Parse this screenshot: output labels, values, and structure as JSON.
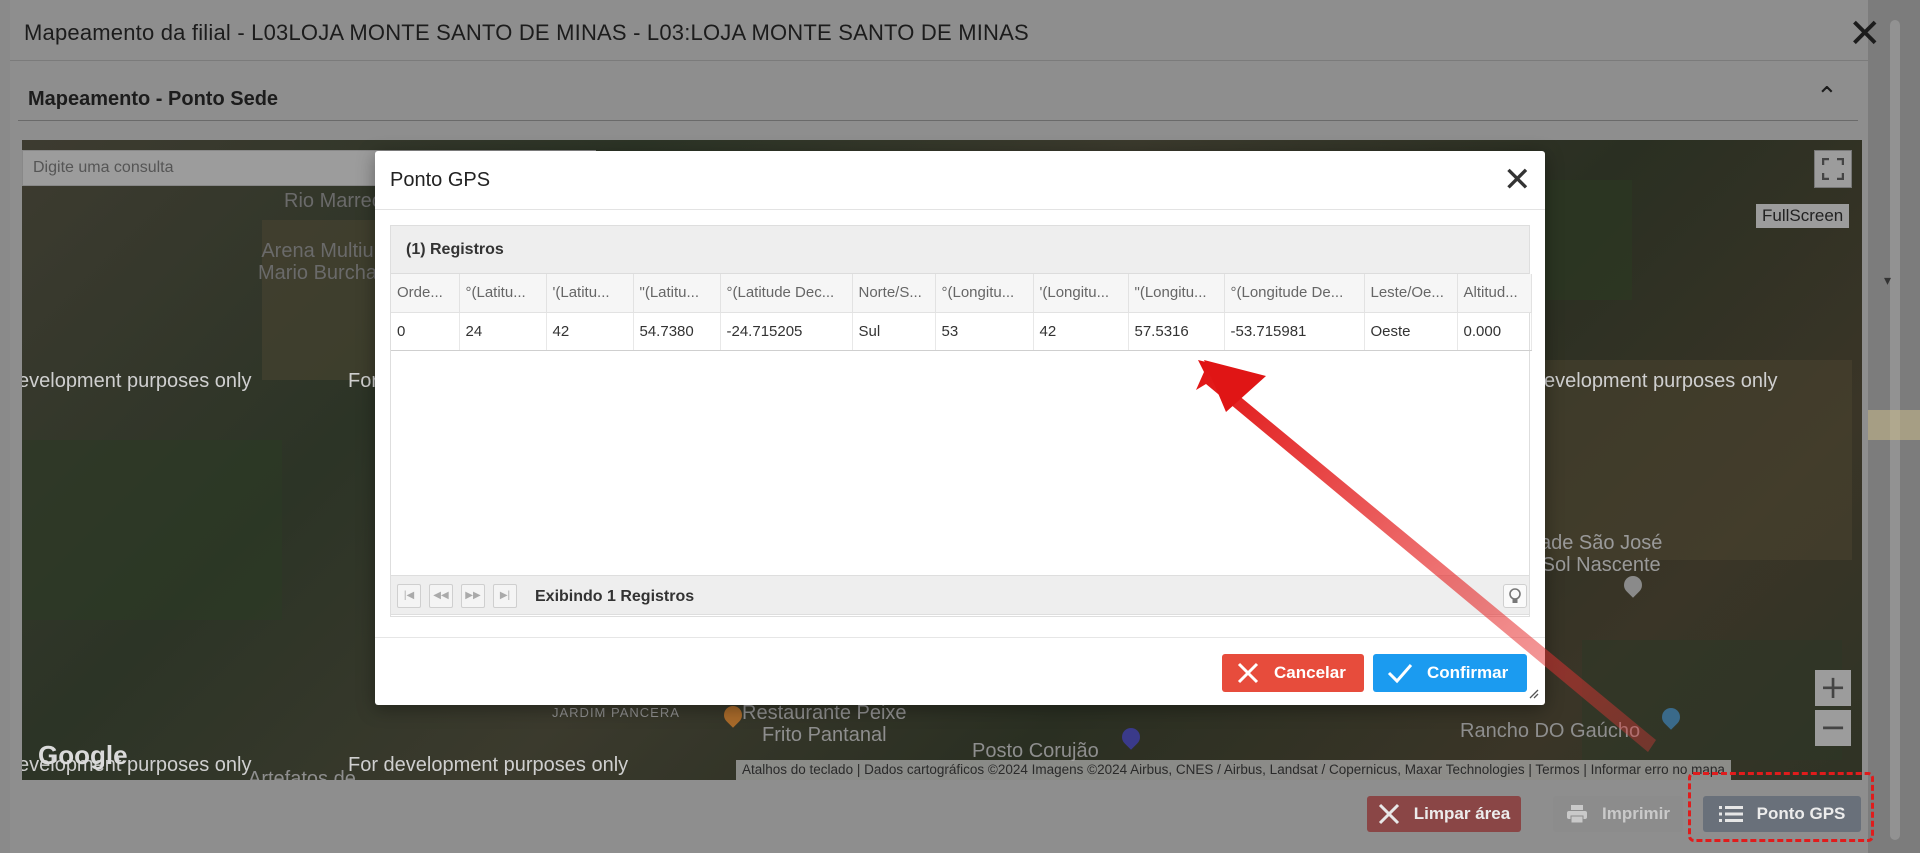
{
  "window": {
    "title": "Mapeamento da filial - L03LOJA MONTE SANTO DE MINAS - L03:LOJA MONTE SANTO DE MINAS",
    "section_title": "Mapeamento - Ponto Sede"
  },
  "map": {
    "search_placeholder": "Digite uma consulta",
    "fullscreen_label": "FullScreen",
    "zoom_in": "+",
    "zoom_out": "−",
    "google": "Google",
    "watermark": "For development purposes only",
    "watermark_partial": "evelopment purposes only",
    "watermark_partial2": "For",
    "places": {
      "rio": "Rio Marreco",
      "arena": "Arena Multiu\nMario Burcha",
      "saojose": "ade São José\nSol Nascente",
      "jardim": "JARDIM PANCERA",
      "restaurante": "Restaurante Peixe\nFrito Pantanal",
      "posto": "Posto Corujão",
      "rancho": "Rancho DO Gaúcho",
      "artefatos": "Artefatos de"
    },
    "attribution": "Atalhos do teclado  |  Dados cartográficos ©2024 Imagens ©2024 Airbus, CNES / Airbus, Landsat / Copernicus, Maxar Technologies  |  Termos  |  Informar erro no mapa"
  },
  "outer_buttons": {
    "limpar": "Limpar área",
    "imprimir": "Imprimir",
    "ponto": "Ponto GPS"
  },
  "modal": {
    "title": "Ponto GPS",
    "registros": "(1) Registros",
    "columns": [
      "Orde...",
      "°(Latitu...",
      "'(Latitu...",
      "\"(Latitu...",
      "°(Latitude Dec...",
      "Norte/S...",
      "°(Longitu...",
      "'(Longitu...",
      "\"(Longitu...",
      "°(Longitude De...",
      "Leste/Oe...",
      "Altitud..."
    ],
    "rows": [
      [
        "0",
        "24",
        "42",
        "54.7380",
        "-24.715205",
        "Sul",
        "53",
        "42",
        "57.5316",
        "-53.715981",
        "Oeste",
        "0.000"
      ]
    ],
    "pager_text": "Exibindo 1 Registros",
    "cancel": "Cancelar",
    "confirm": "Confirmar"
  },
  "colors": {
    "cancel": "#e74c3c",
    "confirm": "#1b9bf0",
    "annotation": "#e01c1c"
  },
  "icons": [
    "close-icon",
    "chevron-up-icon",
    "fullscreen-icon",
    "first-page-icon",
    "prev-page-icon",
    "next-page-icon",
    "last-page-icon",
    "lightbulb-icon",
    "x-icon",
    "check-icon",
    "printer-icon",
    "list-icon"
  ]
}
